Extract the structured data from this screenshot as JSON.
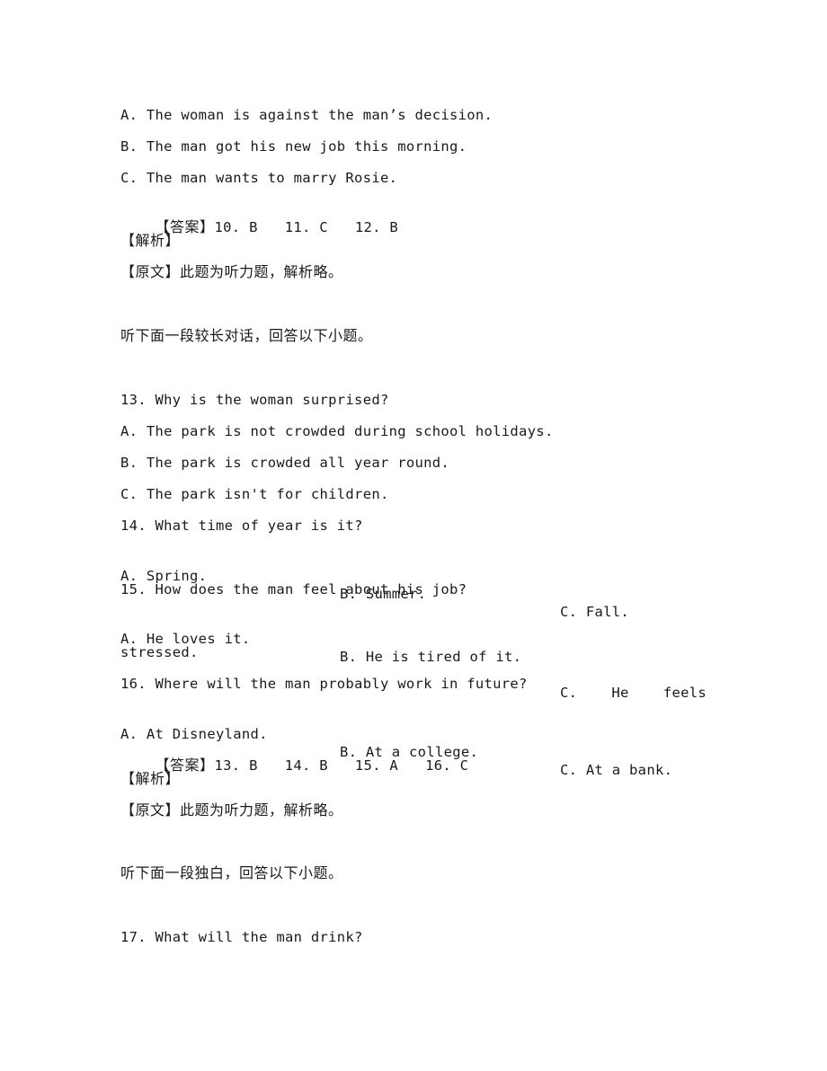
{
  "q12_options": [
    "A. The woman is against the man’s decision.",
    "B. The man got his new job this morning.",
    "C. The man wants to marry Rosie."
  ],
  "answers_1": {
    "label": "【答案】",
    "items": [
      "10. B",
      "11. C",
      "12. B"
    ]
  },
  "analysis_label_1": "【解析】",
  "original_1": "【原文】此题为听力题，解析略。",
  "section_2_intro": "听下面一段较长对话，回答以下小题。",
  "q13": {
    "question": "13. Why is the woman surprised?",
    "options": [
      "A. The park is not crowded during school holidays.",
      "B. The park is crowded all year round.",
      "C. The park isn't for children."
    ]
  },
  "q14": {
    "question": "14. What time of year is it?",
    "options": [
      "A. Spring.",
      "B. Summer.",
      "C. Fall."
    ]
  },
  "q15": {
    "question": "15. How does the man feel about his job?",
    "options": [
      "A. He loves it.",
      "B. He is tired of it.",
      "C. He feels stressed."
    ],
    "c_parts": [
      "C.",
      "He",
      "feels"
    ],
    "c_wrap": "stressed."
  },
  "q16": {
    "question": "16. Where will the man probably work in future?",
    "options": [
      "A. At Disneyland.",
      "B. At a college.",
      "C. At a bank."
    ]
  },
  "answers_2": {
    "label": "【答案】",
    "items": [
      "13. B",
      "14. B",
      "15. A",
      "16. C"
    ]
  },
  "analysis_label_2": "【解析】",
  "original_2": "【原文】此题为听力题，解析略。",
  "section_3_intro": "听下面一段独白，回答以下小题。",
  "q17": {
    "question": "17. What will the man drink?"
  }
}
